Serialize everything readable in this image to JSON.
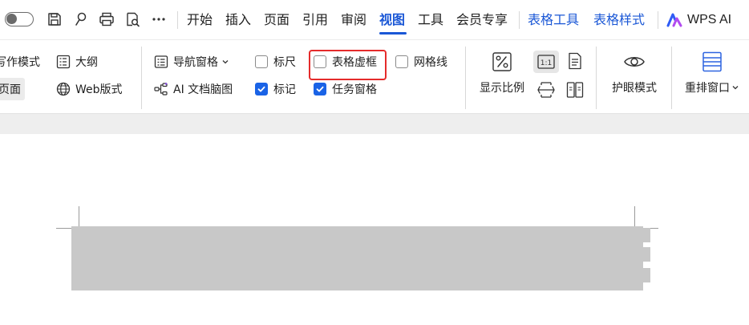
{
  "menubar": {
    "quick_icons": [
      "save-icon",
      "format-painter-icon",
      "print-icon",
      "print-preview-icon",
      "more-icon"
    ],
    "tabs": [
      {
        "label": "开始"
      },
      {
        "label": "插入"
      },
      {
        "label": "页面"
      },
      {
        "label": "引用"
      },
      {
        "label": "审阅"
      },
      {
        "label": "视图",
        "active": true
      },
      {
        "label": "工具"
      },
      {
        "label": "会员专享"
      }
    ],
    "context_tabs": [
      {
        "label": "表格工具"
      },
      {
        "label": "表格样式"
      }
    ],
    "wps_ai_label": "WPS AI",
    "accent_color": "#1a57d6"
  },
  "ribbon": {
    "left_group": {
      "writing_mode_label": "写作模式",
      "outline_label": "大纲",
      "page_label": "页面",
      "web_layout_label": "Web版式"
    },
    "nav_group": {
      "nav_pane_label": "导航窗格",
      "ai_mindmap_label": "AI 文档脑图"
    },
    "show_group": {
      "ruler": {
        "label": "标尺",
        "checked": false
      },
      "table_gridlines": {
        "label": "表格虚框",
        "checked": false,
        "highlighted": true
      },
      "gridlines": {
        "label": "网格线",
        "checked": false
      },
      "marks": {
        "label": "标记",
        "checked": true
      },
      "task_pane": {
        "label": "任务窗格",
        "checked": true
      }
    },
    "zoom_group": {
      "zoom_label": "显示比例",
      "one_to_one_label": "1:1"
    },
    "eye_group": {
      "eye_mode_label": "护眼模式"
    },
    "window_group": {
      "rearrange_label": "重排窗口"
    },
    "highlight_color": "#e52b2b",
    "checkbox_color": "#1a63e6"
  }
}
